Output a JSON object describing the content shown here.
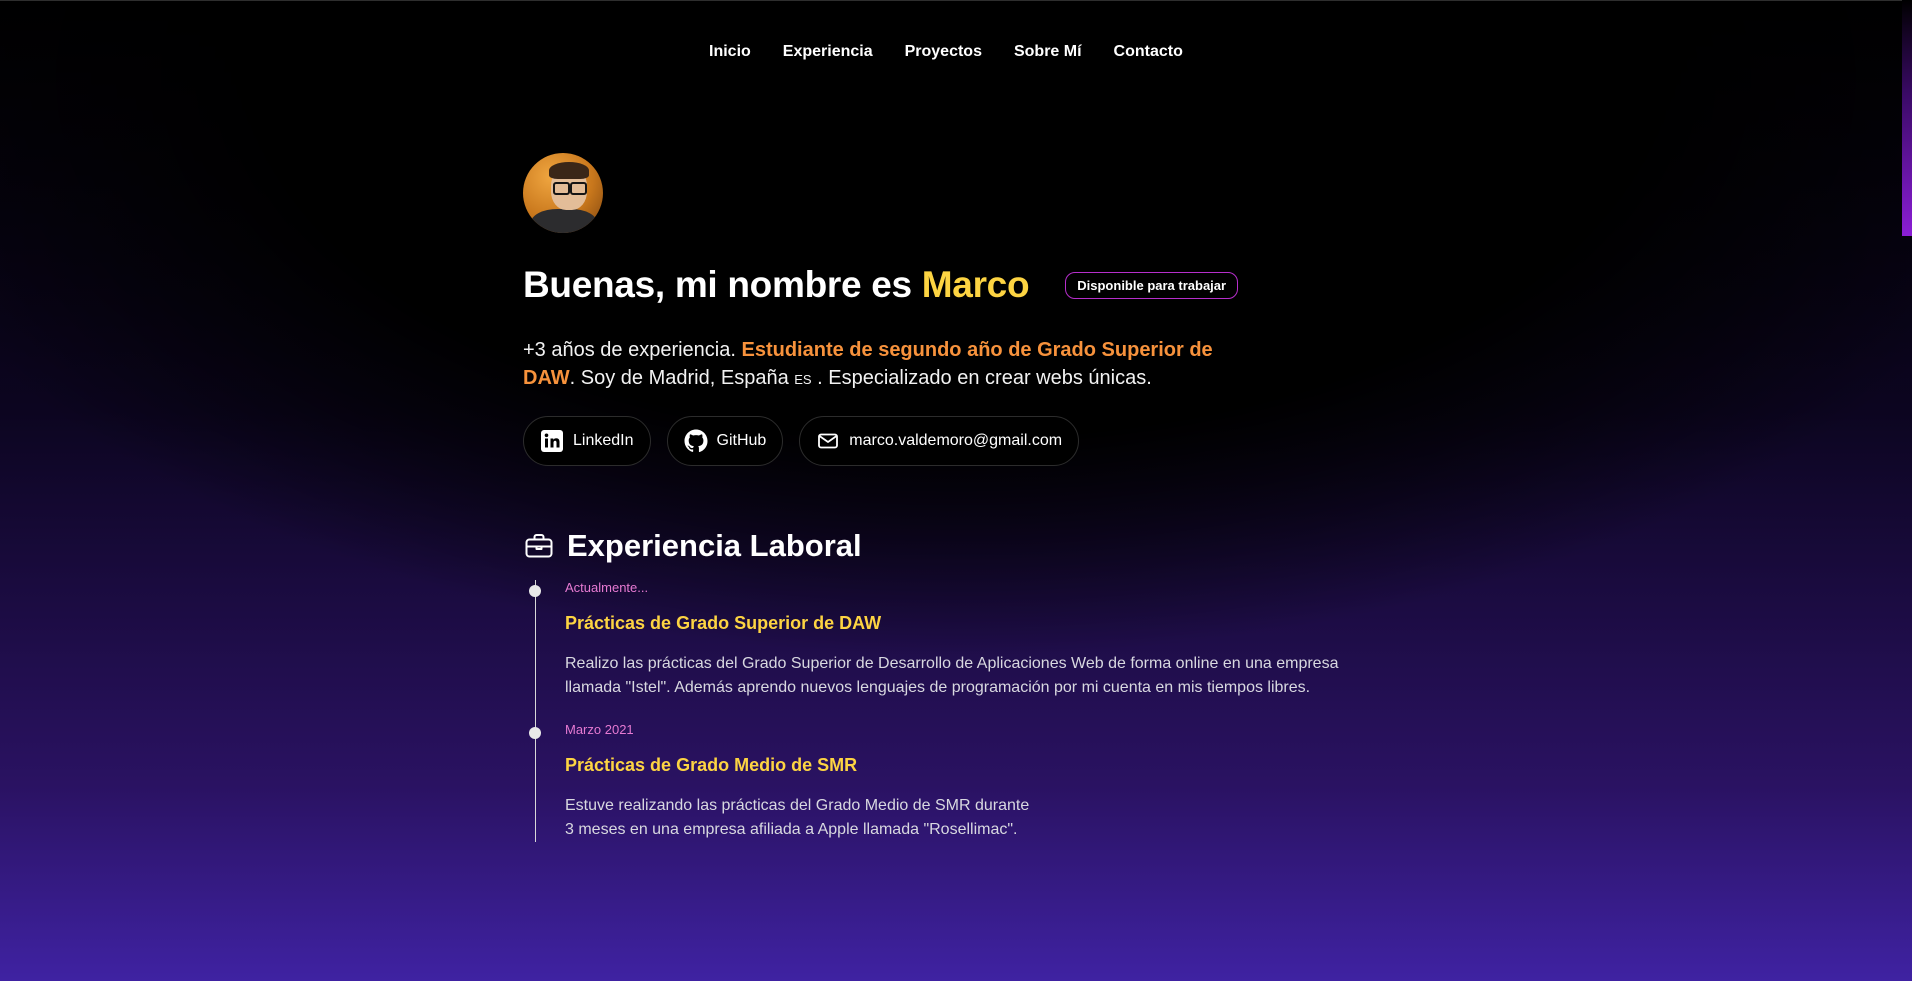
{
  "nav": {
    "items": [
      {
        "label": "Inicio"
      },
      {
        "label": "Experiencia"
      },
      {
        "label": "Proyectos"
      },
      {
        "label": "Sobre Mí"
      },
      {
        "label": "Contacto"
      }
    ]
  },
  "hero": {
    "greeting": "Buenas, mi nombre es ",
    "name": "Marco",
    "badge": "Disponible para trabajar",
    "bio_prefix": "+3 años de experiencia. ",
    "bio_highlight": "Estudiante de segundo año de Grado Superior de DAW",
    "bio_middle": ". Soy de Madrid, España ",
    "bio_flag": "ES",
    "bio_suffix": " . Especializado en crear webs únicas."
  },
  "links": [
    {
      "label": "LinkedIn",
      "icon": "linkedin-icon"
    },
    {
      "label": "GitHub",
      "icon": "github-icon"
    },
    {
      "label": "marco.valdemoro@gmail.com",
      "icon": "mail-icon"
    }
  ],
  "experience": {
    "title": "Experiencia Laboral",
    "icon": "briefcase-icon",
    "items": [
      {
        "date": "Actualmente...",
        "title": "Prácticas de Grado Superior de DAW",
        "desc_lines": [
          "Realizo las prácticas del Grado Superior de Desarrollo de Aplicaciones Web de forma online en una empresa",
          "llamada \"Istel\". Además aprendo nuevos lenguajes de programación por mi cuenta en mis tiempos libres."
        ]
      },
      {
        "date": "Marzo 2021",
        "title": "Prácticas de Grado Medio de SMR",
        "desc_lines": [
          "Estuve realizando las prácticas del Grado Medio de SMR durante",
          "3 meses en una empresa afiliada a Apple llamada \"Rosellimac\"."
        ]
      }
    ]
  },
  "colors": {
    "accent_yellow": "#fdd442",
    "accent_orange": "#f7923c",
    "date_pink": "#e67ad2",
    "badge_border": "#b62ecb",
    "bg_purple": "#3f22a2"
  }
}
